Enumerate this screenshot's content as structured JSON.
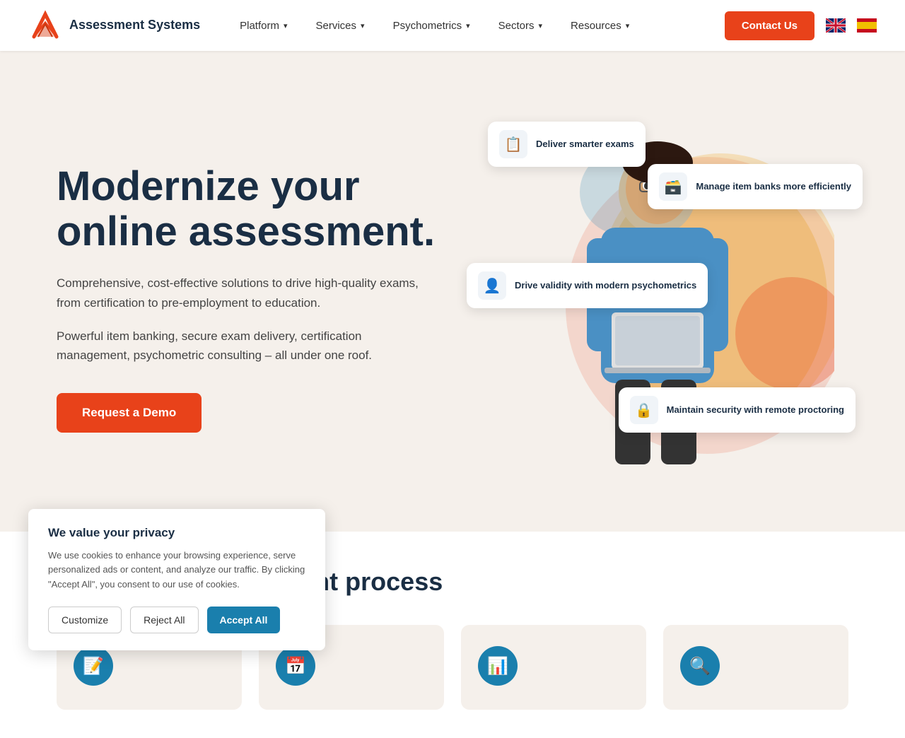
{
  "nav": {
    "logo_name": "Assessment Systems",
    "links": [
      {
        "label": "Platform",
        "active": false
      },
      {
        "label": "Services",
        "active": false
      },
      {
        "label": "Psychometrics",
        "active": false
      },
      {
        "label": "Sectors",
        "active": false
      },
      {
        "label": "Resources",
        "active": false
      }
    ],
    "contact_label": "Contact Us",
    "lang_en": "EN",
    "lang_es": "ES"
  },
  "hero": {
    "title": "Modernize your online assessment.",
    "sub1": "Comprehensive, cost-effective solutions to drive high-quality exams, from certification to pre-employment to education.",
    "sub2": "Powerful item banking, secure exam delivery, certification management, psychometric consulting – all under one roof.",
    "cta_label": "Request a Demo",
    "feature_cards": [
      {
        "id": "deliver",
        "text": "Deliver smarter exams",
        "icon": "📋"
      },
      {
        "id": "manage",
        "text": "Manage item banks more efficiently",
        "icon": "🗃️"
      },
      {
        "id": "validity",
        "text": "Drive validity with modern psychometrics",
        "icon": "👤"
      },
      {
        "id": "security",
        "text": "Maintain security with remote proctoring",
        "icon": "🔒"
      }
    ]
  },
  "bottom_section": {
    "title": "ur online assessment process",
    "title_prefix": "...",
    "cards": [
      {
        "icon": "📝"
      },
      {
        "icon": "📅"
      },
      {
        "icon": "📊"
      },
      {
        "icon": "🔍"
      }
    ]
  },
  "cookie": {
    "title": "We value your privacy",
    "text": "We use cookies to enhance your browsing experience, serve personalized ads or content, and analyze our traffic. By clicking \"Accept All\", you consent to our use of cookies.",
    "customize_label": "Customize",
    "reject_label": "Reject All",
    "accept_label": "Accept All"
  }
}
